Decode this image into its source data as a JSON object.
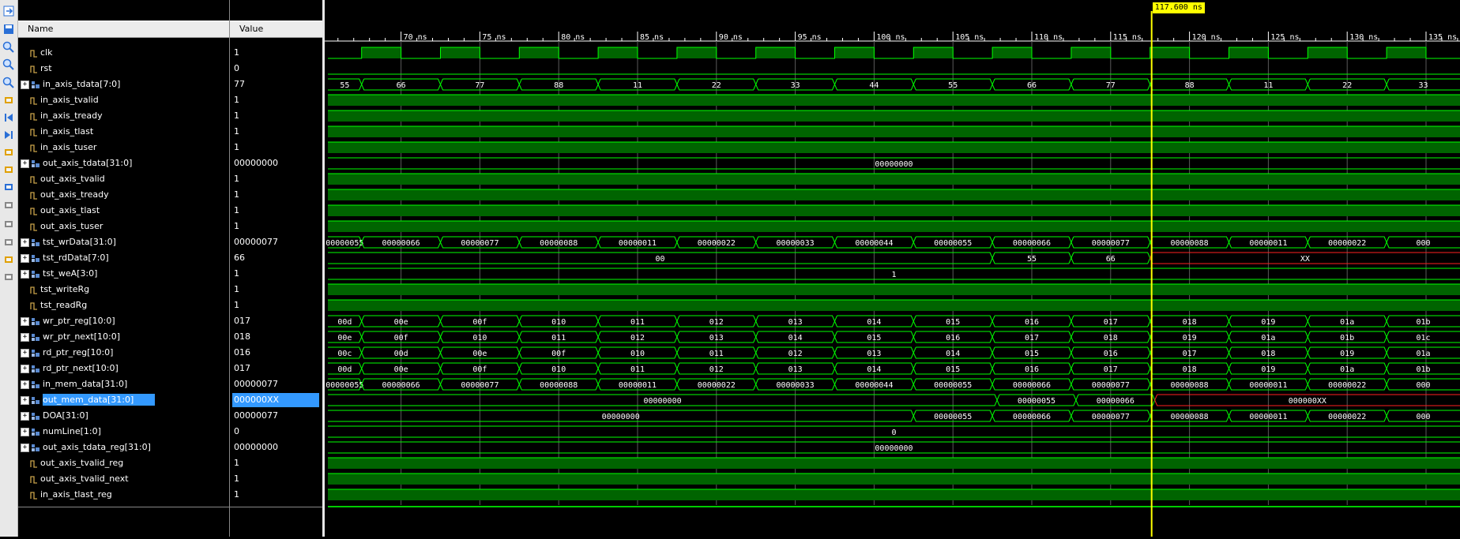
{
  "columns": {
    "name": "Name",
    "value": "Value"
  },
  "cursor": {
    "label": "117.600 ns",
    "time": 117.6
  },
  "timeline": {
    "ticks": [
      "70 ns",
      "75 ns",
      "80 ns",
      "85 ns",
      "90 ns",
      "95 ns",
      "100 ns",
      "105 ns",
      "110 ns",
      "115 ns",
      "120 ns",
      "125 ns",
      "130 ns",
      "135 ns"
    ],
    "tick_times": [
      70,
      75,
      80,
      85,
      90,
      95,
      100,
      105,
      110,
      115,
      120,
      125,
      130,
      135
    ]
  },
  "toolbar_icons": [
    "exit-icon",
    "save-icon",
    "zoom-in-icon",
    "zoom-out-icon",
    "zoom-fit-icon",
    "goto-cursor-icon",
    "goto-start-icon",
    "goto-end-icon",
    "prev-transition-icon",
    "next-transition-icon",
    "add-marker-icon",
    "prev-marker-icon",
    "next-marker-icon",
    "swap-cursors-icon",
    "snap-to-transition-icon",
    "floating-ruler-icon"
  ],
  "signals": [
    {
      "name": "clk",
      "value": "1",
      "bus": false
    },
    {
      "name": "rst",
      "value": "0",
      "bus": false
    },
    {
      "name": "in_axis_tdata[7:0]",
      "value": "77",
      "bus": true
    },
    {
      "name": "in_axis_tvalid",
      "value": "1",
      "bus": false
    },
    {
      "name": "in_axis_tready",
      "value": "1",
      "bus": false
    },
    {
      "name": "in_axis_tlast",
      "value": "1",
      "bus": false
    },
    {
      "name": "in_axis_tuser",
      "value": "1",
      "bus": false
    },
    {
      "name": "out_axis_tdata[31:0]",
      "value": "00000000",
      "bus": true
    },
    {
      "name": "out_axis_tvalid",
      "value": "1",
      "bus": false
    },
    {
      "name": "out_axis_tready",
      "value": "1",
      "bus": false
    },
    {
      "name": "out_axis_tlast",
      "value": "1",
      "bus": false
    },
    {
      "name": "out_axis_tuser",
      "value": "1",
      "bus": false
    },
    {
      "name": "tst_wrData[31:0]",
      "value": "00000077",
      "bus": true
    },
    {
      "name": "tst_rdData[7:0]",
      "value": "66",
      "bus": true
    },
    {
      "name": "tst_weA[3:0]",
      "value": "1",
      "bus": true
    },
    {
      "name": "tst_writeRg",
      "value": "1",
      "bus": false
    },
    {
      "name": "tst_readRg",
      "value": "1",
      "bus": false
    },
    {
      "name": "wr_ptr_reg[10:0]",
      "value": "017",
      "bus": true
    },
    {
      "name": "wr_ptr_next[10:0]",
      "value": "018",
      "bus": true
    },
    {
      "name": "rd_ptr_reg[10:0]",
      "value": "016",
      "bus": true
    },
    {
      "name": "rd_ptr_next[10:0]",
      "value": "017",
      "bus": true
    },
    {
      "name": "in_mem_data[31:0]",
      "value": "00000077",
      "bus": true
    },
    {
      "name": "out_mem_data[31:0]",
      "value": "000000XX",
      "bus": true,
      "selected": true
    },
    {
      "name": "DOA[31:0]",
      "value": "00000077",
      "bus": true
    },
    {
      "name": "numLine[1:0]",
      "value": "0",
      "bus": true
    },
    {
      "name": "out_axis_tdata_reg[31:0]",
      "value": "00000000",
      "bus": true
    },
    {
      "name": "out_axis_tvalid_reg",
      "value": "1",
      "bus": false
    },
    {
      "name": "out_axis_tvalid_next",
      "value": "1",
      "bus": false
    },
    {
      "name": "in_axis_tlast_reg",
      "value": "1",
      "bus": false
    }
  ],
  "waves": [
    {
      "type": "clk",
      "period": 5,
      "phase": 67.5
    },
    {
      "type": "low"
    },
    {
      "type": "bus",
      "segs": [
        [
          60,
          67.5,
          "55"
        ],
        [
          67.5,
          72.5,
          "66"
        ],
        [
          72.5,
          77.5,
          "77"
        ],
        [
          77.5,
          82.5,
          "88"
        ],
        [
          82.5,
          87.5,
          "11"
        ],
        [
          87.5,
          92.5,
          "22"
        ],
        [
          92.5,
          97.5,
          "33"
        ],
        [
          97.5,
          102.5,
          "44"
        ],
        [
          102.5,
          107.5,
          "55"
        ],
        [
          107.5,
          112.5,
          "66"
        ],
        [
          112.5,
          117.5,
          "77"
        ],
        [
          117.5,
          122.5,
          "88"
        ],
        [
          122.5,
          127.5,
          "11"
        ],
        [
          127.5,
          132.5,
          "22"
        ],
        [
          132.5,
          140,
          "33"
        ]
      ]
    },
    {
      "type": "high"
    },
    {
      "type": "high"
    },
    {
      "type": "high"
    },
    {
      "type": "high"
    },
    {
      "type": "bus",
      "segs": [
        [
          60,
          140,
          "00000000"
        ]
      ]
    },
    {
      "type": "high"
    },
    {
      "type": "high"
    },
    {
      "type": "high"
    },
    {
      "type": "high"
    },
    {
      "type": "bus",
      "segs": [
        [
          60,
          67.5,
          "00000055"
        ],
        [
          67.5,
          72.5,
          "00000066"
        ],
        [
          72.5,
          77.5,
          "00000077"
        ],
        [
          77.5,
          82.5,
          "00000088"
        ],
        [
          82.5,
          87.5,
          "00000011"
        ],
        [
          87.5,
          92.5,
          "00000022"
        ],
        [
          92.5,
          97.5,
          "00000033"
        ],
        [
          97.5,
          102.5,
          "00000044"
        ],
        [
          102.5,
          107.5,
          "00000055"
        ],
        [
          107.5,
          112.5,
          "00000066"
        ],
        [
          112.5,
          117.5,
          "00000077"
        ],
        [
          117.5,
          122.5,
          "00000088"
        ],
        [
          122.5,
          127.5,
          "00000011"
        ],
        [
          127.5,
          132.5,
          "00000022"
        ],
        [
          132.5,
          140,
          "000"
        ]
      ]
    },
    {
      "type": "bus",
      "segs": [
        [
          60,
          107.5,
          "00"
        ],
        [
          107.5,
          112.5,
          "55"
        ],
        [
          112.5,
          117.5,
          "66"
        ],
        [
          117.5,
          140,
          "XX",
          "x"
        ]
      ]
    },
    {
      "type": "bus",
      "segs": [
        [
          60,
          140,
          "1"
        ]
      ]
    },
    {
      "type": "high"
    },
    {
      "type": "high"
    },
    {
      "type": "bus",
      "segs": [
        [
          60,
          67.5,
          "00d"
        ],
        [
          67.5,
          72.5,
          "00e"
        ],
        [
          72.5,
          77.5,
          "00f"
        ],
        [
          77.5,
          82.5,
          "010"
        ],
        [
          82.5,
          87.5,
          "011"
        ],
        [
          87.5,
          92.5,
          "012"
        ],
        [
          92.5,
          97.5,
          "013"
        ],
        [
          97.5,
          102.5,
          "014"
        ],
        [
          102.5,
          107.5,
          "015"
        ],
        [
          107.5,
          112.5,
          "016"
        ],
        [
          112.5,
          117.5,
          "017"
        ],
        [
          117.5,
          122.5,
          "018"
        ],
        [
          122.5,
          127.5,
          "019"
        ],
        [
          127.5,
          132.5,
          "01a"
        ],
        [
          132.5,
          140,
          "01b"
        ]
      ]
    },
    {
      "type": "bus",
      "segs": [
        [
          60,
          67.5,
          "00e"
        ],
        [
          67.5,
          72.5,
          "00f"
        ],
        [
          72.5,
          77.5,
          "010"
        ],
        [
          77.5,
          82.5,
          "011"
        ],
        [
          82.5,
          87.5,
          "012"
        ],
        [
          87.5,
          92.5,
          "013"
        ],
        [
          92.5,
          97.5,
          "014"
        ],
        [
          97.5,
          102.5,
          "015"
        ],
        [
          102.5,
          107.5,
          "016"
        ],
        [
          107.5,
          112.5,
          "017"
        ],
        [
          112.5,
          117.5,
          "018"
        ],
        [
          117.5,
          122.5,
          "019"
        ],
        [
          122.5,
          127.5,
          "01a"
        ],
        [
          127.5,
          132.5,
          "01b"
        ],
        [
          132.5,
          140,
          "01c"
        ]
      ]
    },
    {
      "type": "bus",
      "segs": [
        [
          60,
          67.5,
          "00c"
        ],
        [
          67.5,
          72.5,
          "00d"
        ],
        [
          72.5,
          77.5,
          "00e"
        ],
        [
          77.5,
          82.5,
          "00f"
        ],
        [
          82.5,
          87.5,
          "010"
        ],
        [
          87.5,
          92.5,
          "011"
        ],
        [
          92.5,
          97.5,
          "012"
        ],
        [
          97.5,
          102.5,
          "013"
        ],
        [
          102.5,
          107.5,
          "014"
        ],
        [
          107.5,
          112.5,
          "015"
        ],
        [
          112.5,
          117.5,
          "016"
        ],
        [
          117.5,
          122.5,
          "017"
        ],
        [
          122.5,
          127.5,
          "018"
        ],
        [
          127.5,
          132.5,
          "019"
        ],
        [
          132.5,
          140,
          "01a"
        ]
      ]
    },
    {
      "type": "bus",
      "segs": [
        [
          60,
          67.5,
          "00d"
        ],
        [
          67.5,
          72.5,
          "00e"
        ],
        [
          72.5,
          77.5,
          "00f"
        ],
        [
          77.5,
          82.5,
          "010"
        ],
        [
          82.5,
          87.5,
          "011"
        ],
        [
          87.5,
          92.5,
          "012"
        ],
        [
          92.5,
          97.5,
          "013"
        ],
        [
          97.5,
          102.5,
          "014"
        ],
        [
          102.5,
          107.5,
          "015"
        ],
        [
          107.5,
          112.5,
          "016"
        ],
        [
          112.5,
          117.5,
          "017"
        ],
        [
          117.5,
          122.5,
          "018"
        ],
        [
          122.5,
          127.5,
          "019"
        ],
        [
          127.5,
          132.5,
          "01a"
        ],
        [
          132.5,
          140,
          "01b"
        ]
      ]
    },
    {
      "type": "bus",
      "segs": [
        [
          60,
          67.5,
          "00000055"
        ],
        [
          67.5,
          72.5,
          "00000066"
        ],
        [
          72.5,
          77.5,
          "00000077"
        ],
        [
          77.5,
          82.5,
          "00000088"
        ],
        [
          82.5,
          87.5,
          "00000011"
        ],
        [
          87.5,
          92.5,
          "00000022"
        ],
        [
          92.5,
          97.5,
          "00000033"
        ],
        [
          97.5,
          102.5,
          "00000044"
        ],
        [
          102.5,
          107.5,
          "00000055"
        ],
        [
          107.5,
          112.5,
          "00000066"
        ],
        [
          112.5,
          117.5,
          "00000077"
        ],
        [
          117.5,
          122.5,
          "00000088"
        ],
        [
          122.5,
          127.5,
          "00000011"
        ],
        [
          127.5,
          132.5,
          "00000022"
        ],
        [
          132.5,
          140,
          "000"
        ]
      ]
    },
    {
      "type": "bus",
      "segs": [
        [
          60,
          107.8,
          "00000000"
        ],
        [
          107.8,
          112.8,
          "00000055"
        ],
        [
          112.8,
          117.8,
          "00000066"
        ],
        [
          117.8,
          140,
          "000000XX",
          "x"
        ]
      ]
    },
    {
      "type": "bus",
      "segs": [
        [
          60,
          102.5,
          "00000000"
        ],
        [
          102.5,
          107.5,
          "00000055"
        ],
        [
          107.5,
          112.5,
          "00000066"
        ],
        [
          112.5,
          117.5,
          "00000077"
        ],
        [
          117.5,
          122.5,
          "00000088"
        ],
        [
          122.5,
          127.5,
          "00000011"
        ],
        [
          127.5,
          132.5,
          "00000022"
        ],
        [
          132.5,
          140,
          "000"
        ]
      ]
    },
    {
      "type": "bus",
      "segs": [
        [
          60,
          140,
          "0"
        ]
      ]
    },
    {
      "type": "bus",
      "segs": [
        [
          60,
          140,
          "00000000"
        ]
      ]
    },
    {
      "type": "high"
    },
    {
      "type": "high"
    },
    {
      "type": "high"
    }
  ]
}
